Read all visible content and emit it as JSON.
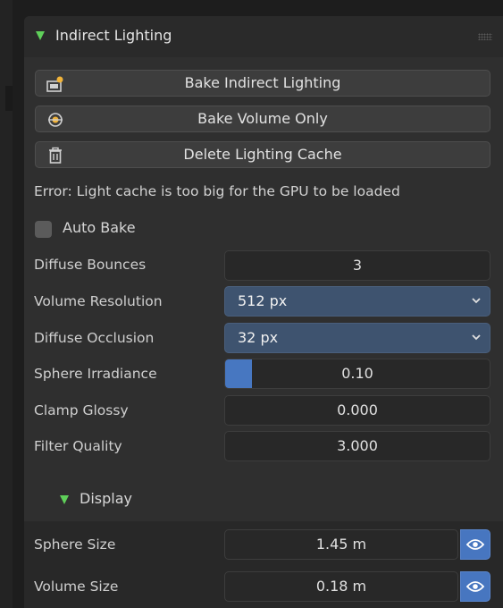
{
  "panel": {
    "title": "Indirect Lighting",
    "icons": {
      "collapse": "triangle-down-icon",
      "drag": "drag-handle-icon"
    }
  },
  "buttons": {
    "bake_indirect": {
      "label": "Bake Indirect Lighting",
      "icon": "bake-light-icon"
    },
    "bake_volume": {
      "label": "Bake Volume Only",
      "icon": "light-probe-icon"
    },
    "delete_cache": {
      "label": "Delete Lighting Cache",
      "icon": "trash-icon"
    }
  },
  "error_message": "Error: Light cache is too big for the GPU to be loaded",
  "auto_bake": {
    "label": "Auto Bake",
    "checked": false
  },
  "properties": {
    "diffuse_bounces": {
      "label": "Diffuse Bounces",
      "value": "3"
    },
    "volume_resolution": {
      "label": "Volume Resolution",
      "value": "512 px"
    },
    "diffuse_occlusion": {
      "label": "Diffuse Occlusion",
      "value": "32 px"
    },
    "sphere_irradiance": {
      "label": "Sphere Irradiance",
      "value": "0.10",
      "fill_fraction": 0.1
    },
    "clamp_glossy": {
      "label": "Clamp Glossy",
      "value": "0.000"
    },
    "filter_quality": {
      "label": "Filter Quality",
      "value": "3.000"
    }
  },
  "display": {
    "title": "Display",
    "sphere_size": {
      "label": "Sphere Size",
      "value": "1.45 m",
      "icon": "eye-icon"
    },
    "volume_size": {
      "label": "Volume Size",
      "value": "0.18 m",
      "icon": "eye-icon"
    }
  },
  "colors": {
    "accent_blue": "#4777c1",
    "select_blue": "#3e536f",
    "triangle_green": "#5fd05a"
  }
}
